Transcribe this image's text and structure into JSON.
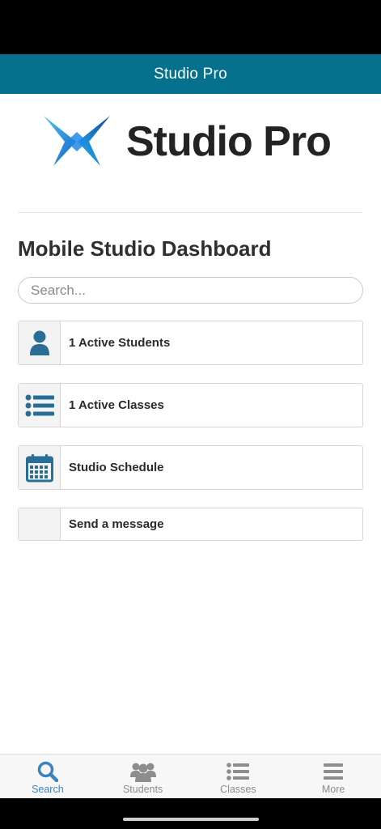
{
  "header": {
    "title": "Studio Pro"
  },
  "logo": {
    "text": "Studio Pro"
  },
  "page": {
    "title": "Mobile Studio Dashboard"
  },
  "search": {
    "placeholder": "Search..."
  },
  "tiles": [
    {
      "label": "1 Active Students",
      "icon": "person-icon"
    },
    {
      "label": "1 Active Classes",
      "icon": "list-icon"
    },
    {
      "label": "Studio Schedule",
      "icon": "calendar-icon"
    },
    {
      "label": "Send a message",
      "icon": ""
    }
  ],
  "tabs": [
    {
      "label": "Search",
      "icon": "search-icon",
      "active": true
    },
    {
      "label": "Students",
      "icon": "group-icon",
      "active": false
    },
    {
      "label": "Classes",
      "icon": "list-icon",
      "active": false
    },
    {
      "label": "More",
      "icon": "menu-icon",
      "active": false
    }
  ],
  "colors": {
    "header": "#05718d",
    "icon": "#2a6d95",
    "active_tab": "#3b83bf",
    "inactive_tab": "#8d8d8d"
  }
}
